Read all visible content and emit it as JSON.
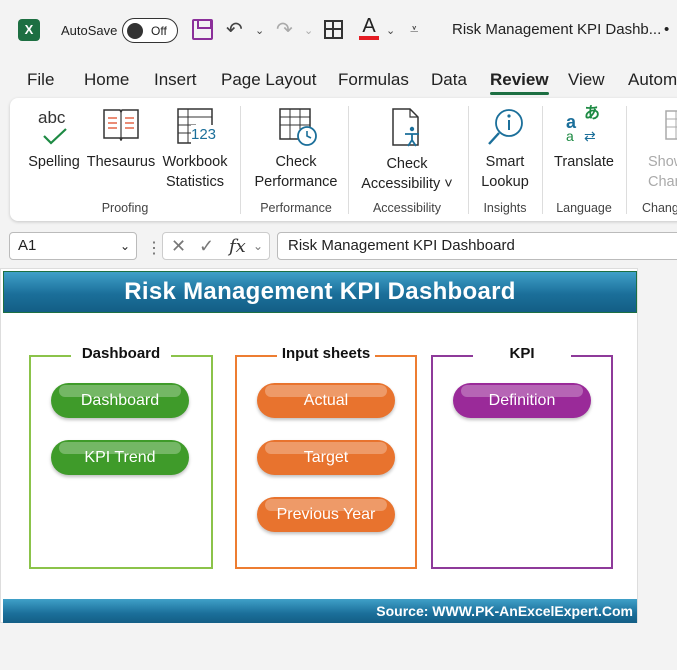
{
  "titlebar": {
    "app_icon": "excel-icon",
    "app_letter": "X",
    "autosave_label": "AutoSave",
    "autosave_state": "Off",
    "document_title": "Risk Management KPI Dashb...",
    "dot": "•"
  },
  "tabs": [
    {
      "label": "File"
    },
    {
      "label": "Home"
    },
    {
      "label": "Insert"
    },
    {
      "label": "Page Layout"
    },
    {
      "label": "Formulas"
    },
    {
      "label": "Data"
    },
    {
      "label": "Review",
      "active": true
    },
    {
      "label": "View"
    },
    {
      "label": "Autom"
    }
  ],
  "ribbon": {
    "groups": {
      "proofing": "Proofing",
      "performance": "Performance",
      "accessibility": "Accessibility",
      "insights": "Insights",
      "language": "Language",
      "changes": "Chang"
    },
    "buttons": {
      "spelling": {
        "line1": "Spelling",
        "icon_text": "abc"
      },
      "thesaurus": {
        "line1": "Thesaurus"
      },
      "workbook_statistics": {
        "line1": "Workbook",
        "line2": "Statistics",
        "icon_text": "123"
      },
      "check_performance": {
        "line1": "Check",
        "line2": "Performance"
      },
      "check_accessibility": {
        "line1": "Check",
        "line2": "Accessibility ˅"
      },
      "smart_lookup": {
        "line1": "Smart",
        "line2": "Lookup"
      },
      "translate": {
        "line1": "Translate"
      },
      "show_changes": {
        "line1": "Show",
        "line2": "Chang"
      }
    }
  },
  "formula_bar": {
    "name_box": "A1",
    "formula": "Risk Management KPI Dashboard"
  },
  "sheet": {
    "title": "Risk Management KPI Dashboard",
    "footer": "Source: WWW.PK-AnExcelExpert.Com",
    "sections": [
      {
        "title": "Dashboard",
        "color": "#8bc34a",
        "buttons": [
          "Dashboard",
          "KPI Trend"
        ],
        "button_color": "#3f9b2a"
      },
      {
        "title": "Input sheets",
        "color": "#ed7d31",
        "buttons": [
          "Actual",
          "Target",
          "Previous Year"
        ],
        "button_color": "#e8732e"
      },
      {
        "title": "KPI",
        "color": "#8e3a9a",
        "buttons": [
          "Definition"
        ],
        "button_color": "#9a2a99"
      }
    ]
  },
  "colors": {
    "excel_green": "#1d6f42",
    "banner_blue": "#1b6f9a"
  }
}
